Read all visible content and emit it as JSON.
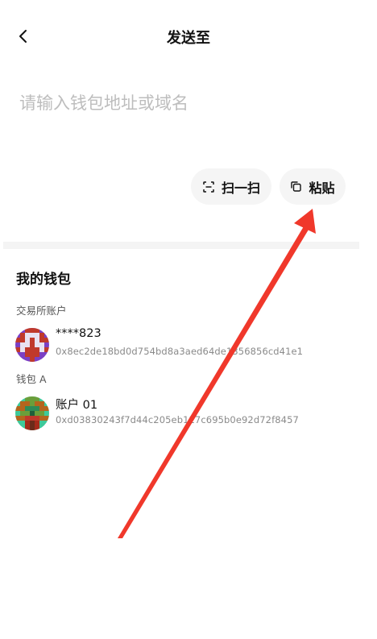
{
  "header": {
    "back_icon": "chevron-left-icon",
    "title": "发送至"
  },
  "address": {
    "placeholder": "请输入钱包地址或域名",
    "value": ""
  },
  "actions": {
    "scan_label": "扫一扫",
    "scan_icon": "scan-icon",
    "paste_label": "粘贴",
    "paste_icon": "copy-icon"
  },
  "my_wallets": {
    "title": "我的钱包",
    "groups": [
      {
        "label": "交易所账户",
        "items": [
          {
            "name": "****823",
            "address": "0x8ec2de18bd0d754bd8a3aed64de1356856cd41e1"
          }
        ]
      },
      {
        "label": "钱包 A",
        "items": [
          {
            "name": "账户 01",
            "address": "0xd03830243f7d44c205eb117c695b0e92d72f8457"
          }
        ]
      }
    ]
  },
  "annotation": {
    "arrow_color": "#f0382b"
  }
}
